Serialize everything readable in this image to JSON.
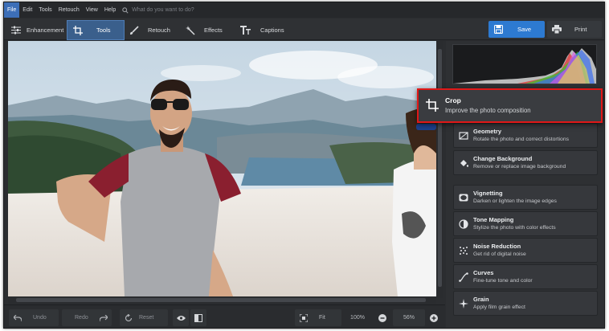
{
  "menu": [
    "File",
    "Edit",
    "Tools",
    "Retouch",
    "View",
    "Help"
  ],
  "search": {
    "placeholder": "What do you want to do?"
  },
  "tabs": [
    {
      "label": "Enhancement",
      "icon": "sliders-icon"
    },
    {
      "label": "Tools",
      "icon": "crop-icon",
      "selected": true
    },
    {
      "label": "Retouch",
      "icon": "brush-icon"
    },
    {
      "label": "Effects",
      "icon": "magic-wand-icon"
    },
    {
      "label": "Captions",
      "icon": "text-icon"
    }
  ],
  "actions": {
    "save": "Save",
    "print": "Print"
  },
  "crop_tooltip": {
    "title": "Crop",
    "desc": "Improve the photo composition"
  },
  "tools": [
    {
      "title": "Geometry",
      "desc": "Rotate the photo and correct distortions",
      "icon": "geometry-icon"
    },
    {
      "title": "Change Background",
      "desc": "Remove or replace image background",
      "icon": "paint-bucket-icon"
    },
    {
      "title": "Vignetting",
      "desc": "Darken or lighten the image edges",
      "icon": "vignette-icon"
    },
    {
      "title": "Tone Mapping",
      "desc": "Stylize the photo with color effects",
      "icon": "half-circle-icon"
    },
    {
      "title": "Noise Reduction",
      "desc": "Get rid of digital noise",
      "icon": "noise-icon"
    },
    {
      "title": "Curves",
      "desc": "Fine-tune tone and color",
      "icon": "curves-icon"
    },
    {
      "title": "Grain",
      "desc": "Apply film grain effect",
      "icon": "grain-icon"
    }
  ],
  "bottom": {
    "undo": "Undo",
    "redo": "Redo",
    "reset": "Reset",
    "fit": "Fit",
    "zoom_100": "100%",
    "zoom_level": "56%"
  },
  "colors": {
    "accent": "#2d7ad1",
    "highlight": "#e01818"
  }
}
